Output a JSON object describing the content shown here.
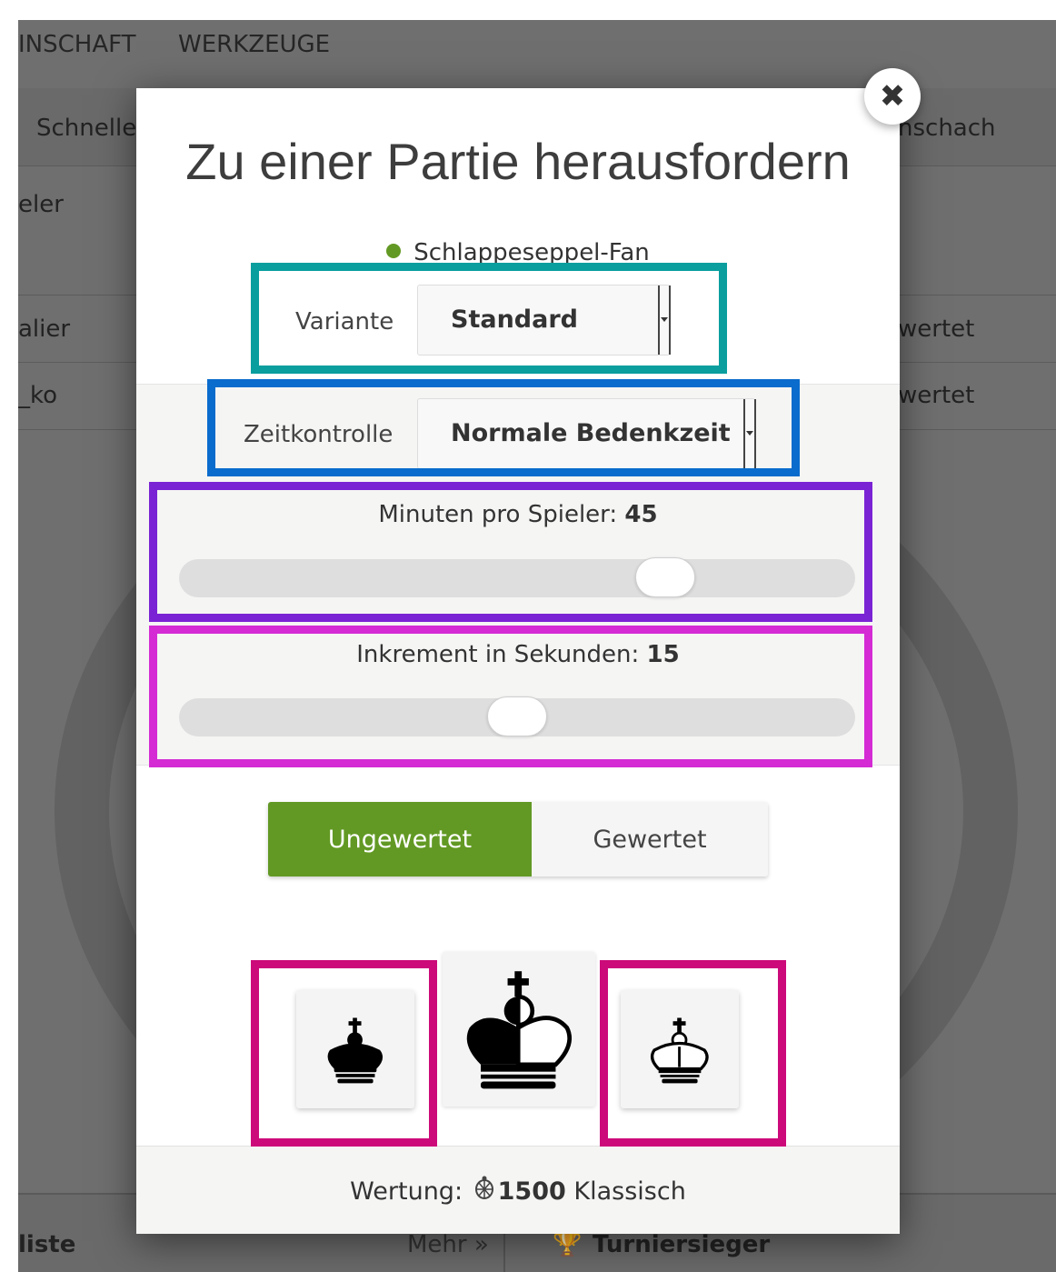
{
  "background": {
    "nav_items": [
      "INSCHAFT",
      "WERKZEUGE"
    ],
    "tab_left": "Schnelles",
    "tab_right": "nschach",
    "side_label": "eler",
    "rows": [
      {
        "left": "alier",
        "right": "wertet"
      },
      {
        "left": "_ko",
        "right": "wertet"
      }
    ],
    "bottom": {
      "left": "liste",
      "more": "Mehr »",
      "tournament": "Turniersieger"
    }
  },
  "modal": {
    "title": "Zu einer Partie herausfordern",
    "opponent": "Schlappeseppel-Fan",
    "variant": {
      "label": "Variante",
      "value": "Standard"
    },
    "time_control": {
      "label": "Zeitkontrolle",
      "value": "Normale Bedenkzeit"
    },
    "minutes": {
      "label": "Minuten pro Spieler:",
      "value": "45",
      "slider_fraction": 0.74
    },
    "increment": {
      "label": "Inkrement in Sekunden:",
      "value": "15",
      "slider_fraction": 0.5
    },
    "mode": {
      "casual": "Ungewertet",
      "rated": "Gewertet",
      "selected": "casual"
    },
    "color_choices": [
      {
        "name": "black",
        "icon": "black-king-icon"
      },
      {
        "name": "random",
        "icon": "half-king-icon"
      },
      {
        "name": "white",
        "icon": "white-king-icon"
      }
    ],
    "footer": {
      "prefix": "Wertung:",
      "rating": "1500",
      "suffix": "Klassisch",
      "icon": "turtle-icon"
    }
  },
  "colors": {
    "accent_green": "#629924",
    "highlight_teal": "#0a9e9e",
    "highlight_blue": "#0a6ccc",
    "highlight_purple": "#7a23d4",
    "highlight_magenta": "#d42bd4",
    "highlight_crimson": "#cc0a7a"
  }
}
